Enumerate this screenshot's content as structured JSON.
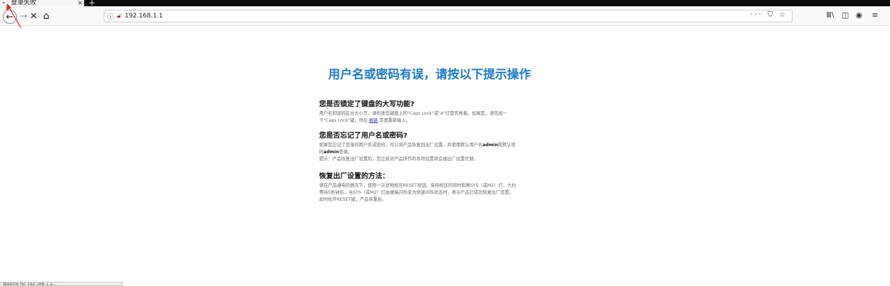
{
  "tab": {
    "title": "登录失败",
    "close": "×",
    "new": "+"
  },
  "toolbar": {
    "back": "←",
    "forward": "→",
    "stop": "✕",
    "home": "⌂",
    "url": "192.168.1.1",
    "page_actions": "··· ⛉ ☆",
    "library": "Ⅲ\\",
    "sidebar": "◫",
    "account": "◉",
    "menu": "≡"
  },
  "main": {
    "heading": "用户名或密码有误，请按以下提示操作",
    "sections": [
      {
        "title": "您是否锁定了键盘的大写功能?",
        "line1": "用户名和密码区分大小写，请检查您键盘上的\"Caps Lock\"或\"A\"灯是否亮着。如果是，请先按一",
        "line2_pre": "下\"Caps Lock\"键，然后 ",
        "link": "刷新",
        "line2_post": " 页面重新输入。"
      },
      {
        "title": "您是否忘记了用户名或密码?",
        "line1_pre": "如果您忘记了登录的用户名或密码，可以将产品恢复到出厂设置，并使用默认用户名",
        "bold1": "admin",
        "line1_post": "和默认密",
        "line2_pre": "码",
        "bold2": "admin",
        "line2_post": "登录。",
        "line3": "提示：产品恢复出厂设置后，您之前对产品所作的各项设置将会被出厂设置代替。"
      },
      {
        "title": "恢复出厂设置的方法：",
        "line1": "请在产品通电的情况下，使用一尖状物按压RESET按钮，保持按压的同时观察SYS（或M2）灯，大约",
        "line2": "等待5秒钟后，当SYS（或M2）灯由缓慢闪烁变为快速闪烁状态时，表示产品已成功恢复出厂设置，",
        "line3": "此时松开RESET键，产品将重启。"
      }
    ]
  },
  "status_bar": {
    "text": "Waiting for 192.168.1.1..."
  }
}
